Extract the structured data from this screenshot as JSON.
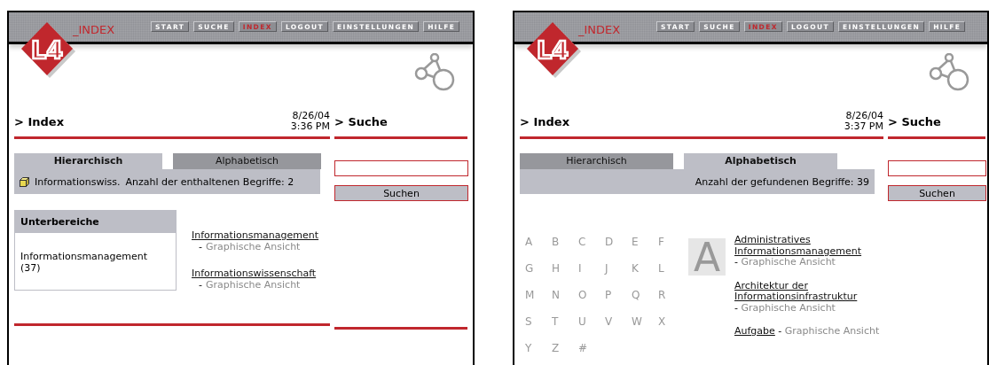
{
  "screens": [
    {
      "kind": "hierarchical",
      "logo": "L4",
      "brand": "_INDEX",
      "nav": [
        {
          "label": "START",
          "selected": false
        },
        {
          "label": "SUCHE",
          "selected": false
        },
        {
          "label": "INDEX",
          "selected": true
        },
        {
          "label": "LOGOUT",
          "selected": false
        },
        {
          "label": "EINSTELLUNGEN",
          "selected": false
        },
        {
          "label": "HILFE",
          "selected": false
        }
      ],
      "title": "> Index",
      "date": "8/26/04",
      "time": "3:36 PM",
      "search_title": "> Suche",
      "search_button": "Suchen",
      "tabs": [
        {
          "label": "Hierarchisch",
          "selected": true
        },
        {
          "label": "Alphabetisch",
          "selected": false
        }
      ],
      "status": {
        "path": "Informationswiss.",
        "count": "Anzahl der enthaltenen Begriffe: 2"
      },
      "subareas": {
        "title": "Unterbereiche",
        "items": [
          "Informationsmanagement (37)"
        ]
      },
      "entries": [
        {
          "term": "Informationsmanagement",
          "dash": "-",
          "view": "Graphische Ansicht"
        },
        {
          "term": "Informationswissenschaft",
          "dash": "-",
          "view": "Graphische Ansicht"
        }
      ]
    },
    {
      "kind": "alphabetical",
      "logo": "L4",
      "brand": "_INDEX",
      "nav": [
        {
          "label": "START",
          "selected": false
        },
        {
          "label": "SUCHE",
          "selected": false
        },
        {
          "label": "INDEX",
          "selected": true
        },
        {
          "label": "LOGOUT",
          "selected": false
        },
        {
          "label": "EINSTELLUNGEN",
          "selected": false
        },
        {
          "label": "HILFE",
          "selected": false
        }
      ],
      "title": "> Index",
      "date": "8/26/04",
      "time": "3:37 PM",
      "search_title": "> Suche",
      "search_button": "Suchen",
      "tabs": [
        {
          "label": "Hierarchisch",
          "selected": false
        },
        {
          "label": "Alphabetisch",
          "selected": true
        }
      ],
      "status": {
        "count": "Anzahl der gefundenen Begriffe: 39"
      },
      "letters": [
        "A",
        "B",
        "C",
        "D",
        "E",
        "F",
        "G",
        "H",
        "I",
        "J",
        "K",
        "L",
        "M",
        "N",
        "O",
        "P",
        "Q",
        "R",
        "S",
        "T",
        "U",
        "V",
        "W",
        "X",
        "Y",
        "Z",
        "#"
      ],
      "current_letter": "A",
      "entries": [
        {
          "term": "Administratives Informationsmanagement",
          "dash": "-",
          "view": "Graphische Ansicht"
        },
        {
          "term": "Architektur der Informationsinfrastruktur",
          "dash": "-",
          "view": "Graphische Ansicht"
        },
        {
          "term": "Aufgabe",
          "dash": "-",
          "view": "Graphische Ansicht"
        }
      ]
    }
  ]
}
